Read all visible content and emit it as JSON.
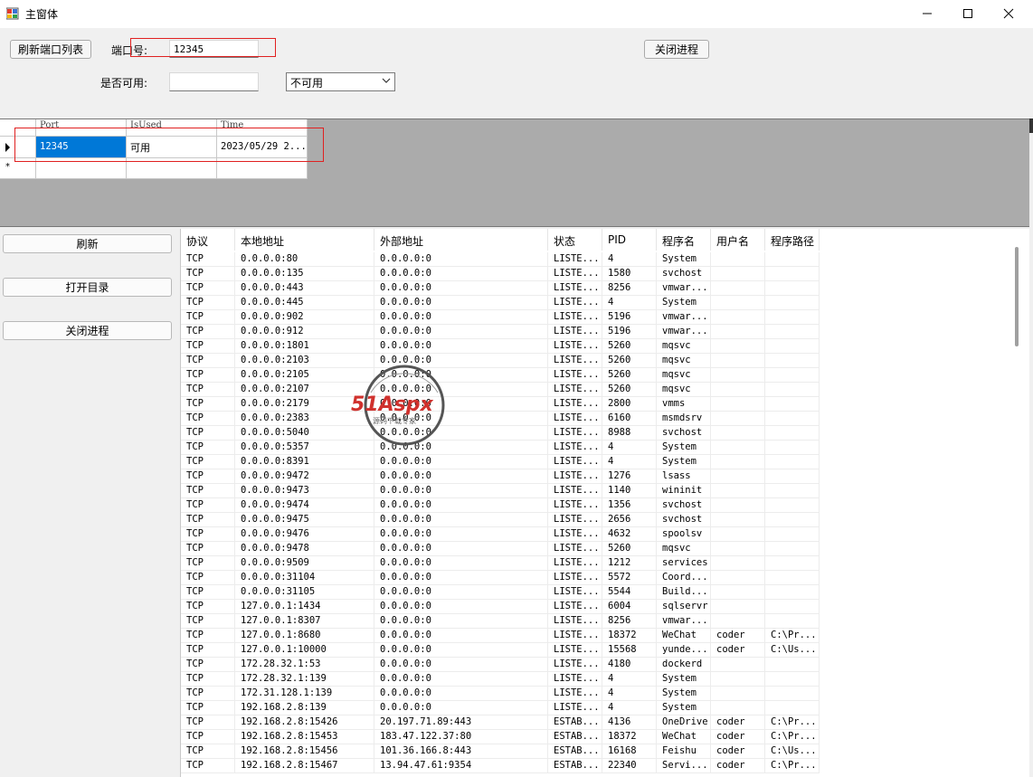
{
  "window": {
    "title": "主窗体"
  },
  "toolbar": {
    "refresh_ports_label": "刷新端口列表",
    "port_label": "端口号:",
    "port_value": "12345",
    "close_process_label": "关闭进程",
    "available_label": "是否可用:",
    "available_input_value": "",
    "available_select_value": "不可用"
  },
  "grid1": {
    "headers": [
      "Port",
      "IsUsed",
      "Time"
    ],
    "rows": [
      [
        "12345",
        "可用",
        "2023/05/29 2..."
      ]
    ]
  },
  "side_buttons": {
    "refresh": "刷新",
    "open_dir": "打开目录",
    "close_process": "关闭进程"
  },
  "listview": {
    "headers": [
      "协议",
      "本地地址",
      "外部地址",
      "状态",
      "PID",
      "程序名",
      "用户名",
      "程序路径"
    ],
    "rows": [
      [
        "TCP",
        "0.0.0.0:80",
        "0.0.0.0:0",
        "LISTE...",
        "4",
        "System",
        "",
        ""
      ],
      [
        "TCP",
        "0.0.0.0:135",
        "0.0.0.0:0",
        "LISTE...",
        "1580",
        "svchost",
        "",
        ""
      ],
      [
        "TCP",
        "0.0.0.0:443",
        "0.0.0.0:0",
        "LISTE...",
        "8256",
        "vmwar...",
        "",
        ""
      ],
      [
        "TCP",
        "0.0.0.0:445",
        "0.0.0.0:0",
        "LISTE...",
        "4",
        "System",
        "",
        ""
      ],
      [
        "TCP",
        "0.0.0.0:902",
        "0.0.0.0:0",
        "LISTE...",
        "5196",
        "vmwar...",
        "",
        ""
      ],
      [
        "TCP",
        "0.0.0.0:912",
        "0.0.0.0:0",
        "LISTE...",
        "5196",
        "vmwar...",
        "",
        ""
      ],
      [
        "TCP",
        "0.0.0.0:1801",
        "0.0.0.0:0",
        "LISTE...",
        "5260",
        "mqsvc",
        "",
        ""
      ],
      [
        "TCP",
        "0.0.0.0:2103",
        "0.0.0.0:0",
        "LISTE...",
        "5260",
        "mqsvc",
        "",
        ""
      ],
      [
        "TCP",
        "0.0.0.0:2105",
        "0.0.0.0:0",
        "LISTE...",
        "5260",
        "mqsvc",
        "",
        ""
      ],
      [
        "TCP",
        "0.0.0.0:2107",
        "0.0.0.0:0",
        "LISTE...",
        "5260",
        "mqsvc",
        "",
        ""
      ],
      [
        "TCP",
        "0.0.0.0:2179",
        "0.0.0.0:0",
        "LISTE...",
        "2800",
        "vmms",
        "",
        ""
      ],
      [
        "TCP",
        "0.0.0.0:2383",
        "0.0.0.0:0",
        "LISTE...",
        "6160",
        "msmdsrv",
        "",
        ""
      ],
      [
        "TCP",
        "0.0.0.0:5040",
        "0.0.0.0:0",
        "LISTE...",
        "8988",
        "svchost",
        "",
        ""
      ],
      [
        "TCP",
        "0.0.0.0:5357",
        "0.0.0.0:0",
        "LISTE...",
        "4",
        "System",
        "",
        ""
      ],
      [
        "TCP",
        "0.0.0.0:8391",
        "0.0.0.0:0",
        "LISTE...",
        "4",
        "System",
        "",
        ""
      ],
      [
        "TCP",
        "0.0.0.0:9472",
        "0.0.0.0:0",
        "LISTE...",
        "1276",
        "lsass",
        "",
        ""
      ],
      [
        "TCP",
        "0.0.0.0:9473",
        "0.0.0.0:0",
        "LISTE...",
        "1140",
        "wininit",
        "",
        ""
      ],
      [
        "TCP",
        "0.0.0.0:9474",
        "0.0.0.0:0",
        "LISTE...",
        "1356",
        "svchost",
        "",
        ""
      ],
      [
        "TCP",
        "0.0.0.0:9475",
        "0.0.0.0:0",
        "LISTE...",
        "2656",
        "svchost",
        "",
        ""
      ],
      [
        "TCP",
        "0.0.0.0:9476",
        "0.0.0.0:0",
        "LISTE...",
        "4632",
        "spoolsv",
        "",
        ""
      ],
      [
        "TCP",
        "0.0.0.0:9478",
        "0.0.0.0:0",
        "LISTE...",
        "5260",
        "mqsvc",
        "",
        ""
      ],
      [
        "TCP",
        "0.0.0.0:9509",
        "0.0.0.0:0",
        "LISTE...",
        "1212",
        "services",
        "",
        ""
      ],
      [
        "TCP",
        "0.0.0.0:31104",
        "0.0.0.0:0",
        "LISTE...",
        "5572",
        "Coord...",
        "",
        ""
      ],
      [
        "TCP",
        "0.0.0.0:31105",
        "0.0.0.0:0",
        "LISTE...",
        "5544",
        "Build...",
        "",
        ""
      ],
      [
        "TCP",
        "127.0.0.1:1434",
        "0.0.0.0:0",
        "LISTE...",
        "6004",
        "sqlservr",
        "",
        ""
      ],
      [
        "TCP",
        "127.0.0.1:8307",
        "0.0.0.0:0",
        "LISTE...",
        "8256",
        "vmwar...",
        "",
        ""
      ],
      [
        "TCP",
        "127.0.0.1:8680",
        "0.0.0.0:0",
        "LISTE...",
        "18372",
        "WeChat",
        "coder",
        "C:\\Pr..."
      ],
      [
        "TCP",
        "127.0.0.1:10000",
        "0.0.0.0:0",
        "LISTE...",
        "15568",
        "yunde...",
        "coder",
        "C:\\Us..."
      ],
      [
        "TCP",
        "172.28.32.1:53",
        "0.0.0.0:0",
        "LISTE...",
        "4180",
        "dockerd",
        "",
        ""
      ],
      [
        "TCP",
        "172.28.32.1:139",
        "0.0.0.0:0",
        "LISTE...",
        "4",
        "System",
        "",
        ""
      ],
      [
        "TCP",
        "172.31.128.1:139",
        "0.0.0.0:0",
        "LISTE...",
        "4",
        "System",
        "",
        ""
      ],
      [
        "TCP",
        "192.168.2.8:139",
        "0.0.0.0:0",
        "LISTE...",
        "4",
        "System",
        "",
        ""
      ],
      [
        "TCP",
        "192.168.2.8:15426",
        "20.197.71.89:443",
        "ESTAB...",
        "4136",
        "OneDrive",
        "coder",
        "C:\\Pr..."
      ],
      [
        "TCP",
        "192.168.2.8:15453",
        "183.47.122.37:80",
        "ESTAB...",
        "18372",
        "WeChat",
        "coder",
        "C:\\Pr..."
      ],
      [
        "TCP",
        "192.168.2.8:15456",
        "101.36.166.8:443",
        "ESTAB...",
        "16168",
        "Feishu",
        "coder",
        "C:\\Us..."
      ],
      [
        "TCP",
        "192.168.2.8:15467",
        "13.94.47.61:9354",
        "ESTAB...",
        "22340",
        "Servi...",
        "coder",
        "C:\\Pr..."
      ]
    ]
  },
  "watermark": {
    "text": "51Aspx",
    "subtext": "源码下载专家"
  },
  "colors": {
    "selection": "#0078d7",
    "highlight_box": "#e02020",
    "grid_bg": "#ababab"
  }
}
